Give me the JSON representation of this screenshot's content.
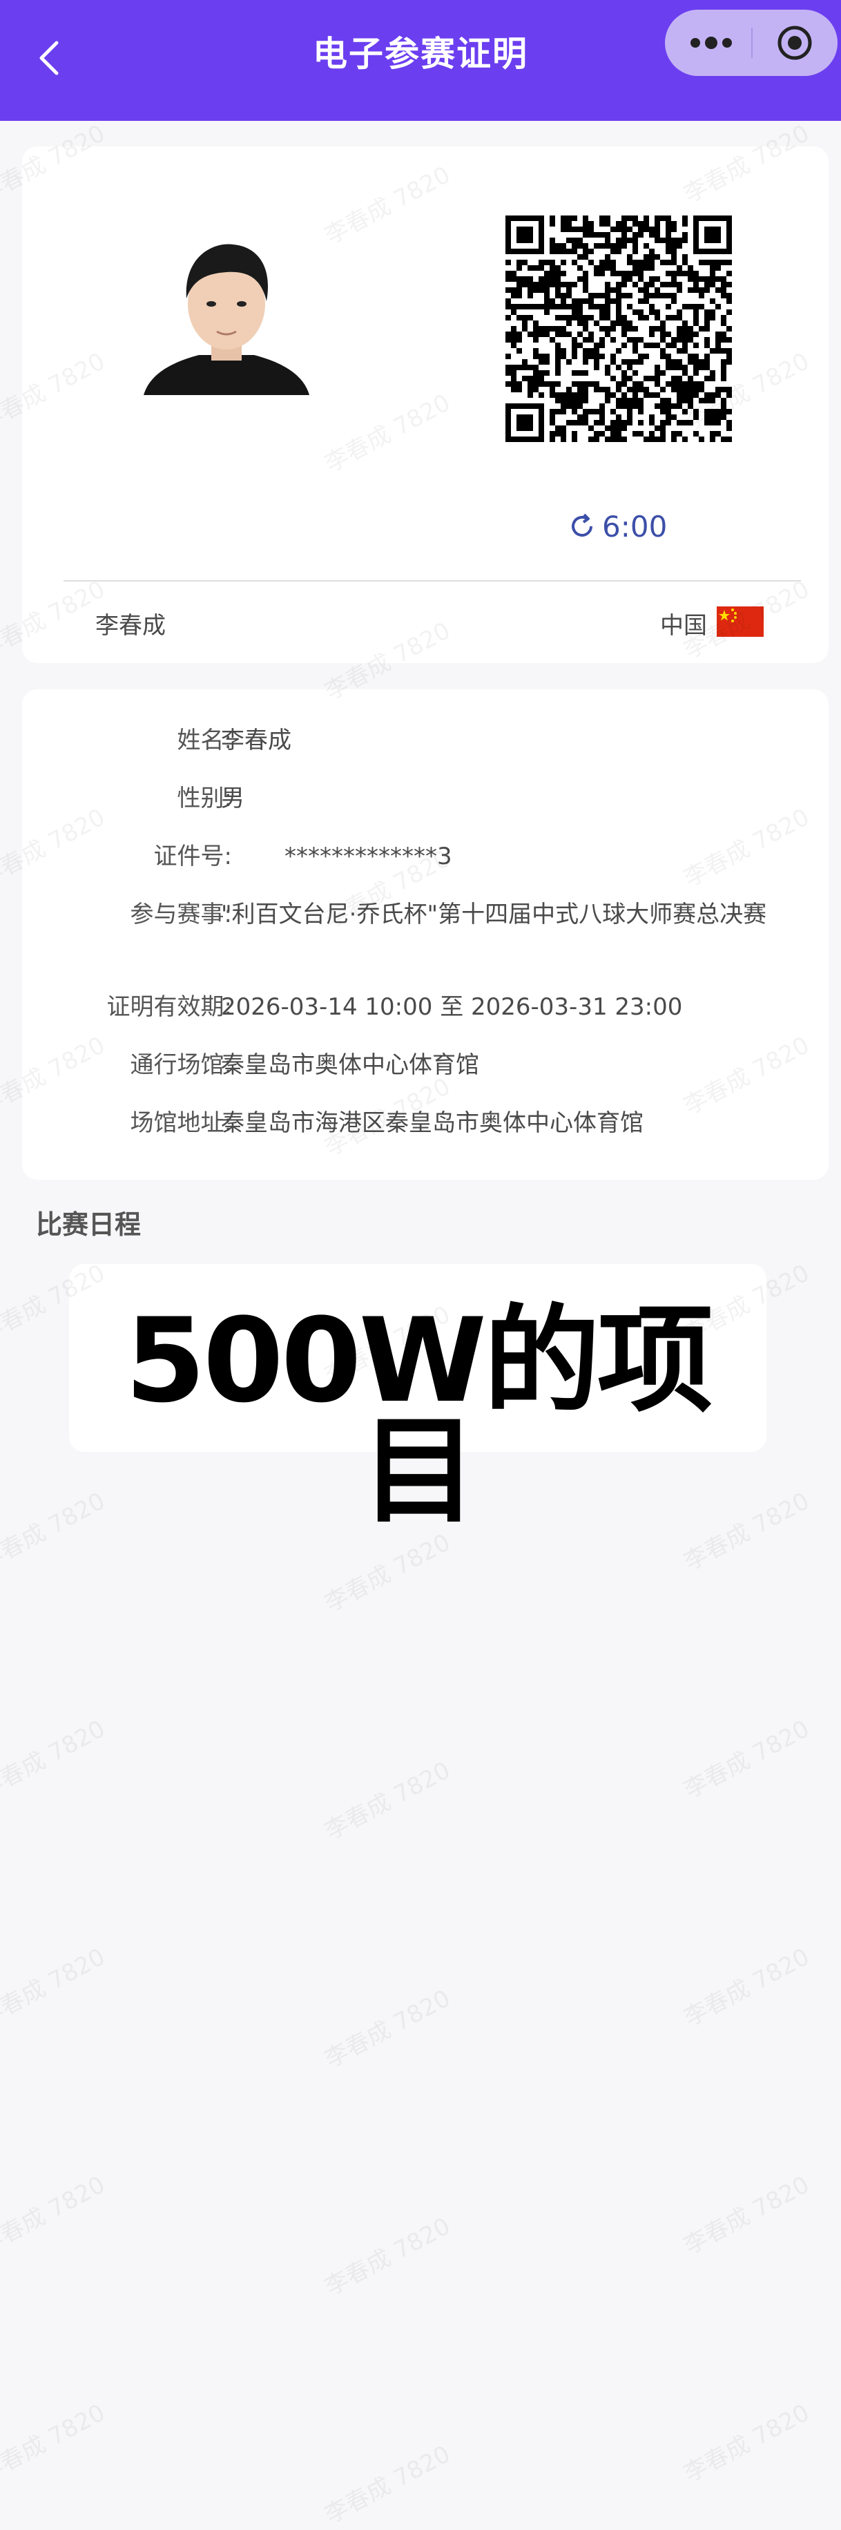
{
  "header": {
    "title": "电子参赛证明"
  },
  "pass": {
    "timer": "6:00",
    "holder_name": "李春成",
    "country": "中国"
  },
  "info": {
    "rows": [
      {
        "label": "姓名:",
        "value": "李春成"
      },
      {
        "label": "性别:",
        "value": "男"
      },
      {
        "label": "证件号:",
        "value": "*************3"
      },
      {
        "label": "参与赛事:",
        "value": "\"利百文台尼·乔氏杯\"第十四届中式八球大师赛总决赛"
      },
      {
        "label": "证明有效期:",
        "value": "2026-03-14 10:00 至 2026-03-31 23:00"
      },
      {
        "label": "通行场馆:",
        "value": "秦皇岛市奥体中心体育馆"
      },
      {
        "label": "场馆地址:",
        "value": "秦皇岛市海港区秦皇岛市奥体中心体育馆"
      }
    ]
  },
  "schedule": {
    "title": "比赛日程",
    "overlay_text": "500W的项目"
  },
  "watermark": "李春成 7820",
  "colors": {
    "accent": "#6b3ef0",
    "timer": "#3c4fa8",
    "flag_red": "#de2910",
    "flag_star": "#ffde00"
  }
}
